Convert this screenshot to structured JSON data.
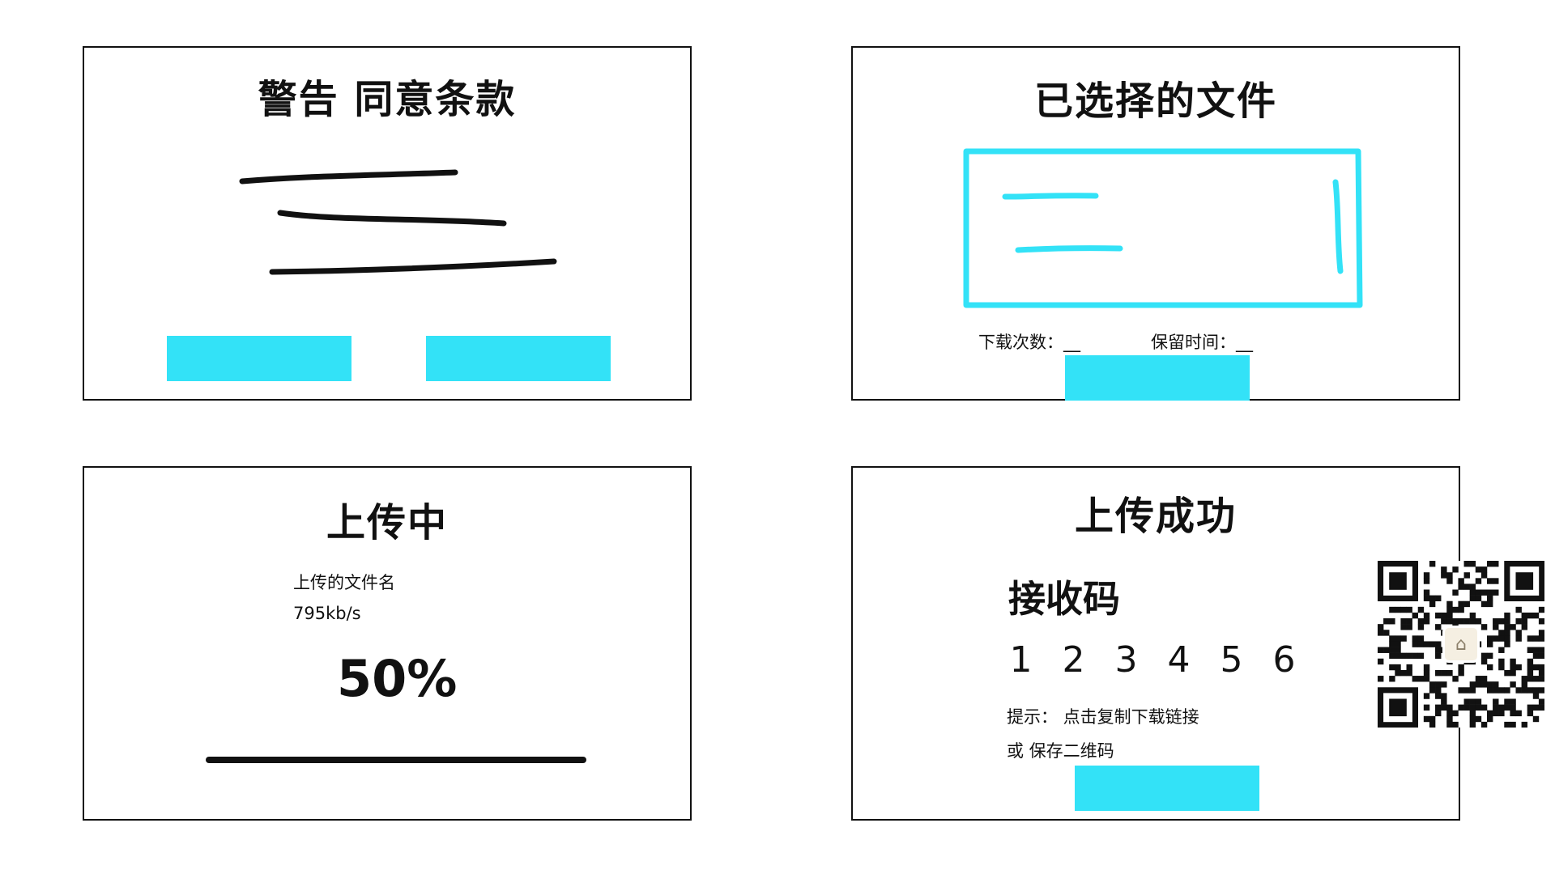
{
  "colors": {
    "accent": "#33e2f7",
    "ink": "#111111",
    "panel_background": "#ffffff"
  },
  "panel_warning": {
    "title": "警告 同意条款",
    "buttons": [
      "",
      ""
    ]
  },
  "panel_selected": {
    "title": "已选择的文件",
    "download_count_label": "下载次数：__",
    "retention_label": "保留时间：__"
  },
  "panel_uploading": {
    "title": "上传中",
    "file_name": "上传的文件名",
    "speed": "795kb/s",
    "progress_text": "50%",
    "progress": 0.5
  },
  "panel_success": {
    "title": "上传成功",
    "receive_code_label": "接收码",
    "code_digits": [
      "1",
      "2",
      "3",
      "4",
      "5",
      "6"
    ],
    "hint_line_1": "提示： 点击复制下载链接",
    "hint_line_2": "或 保存二维码",
    "qr_icon": "qr-code-icon"
  }
}
